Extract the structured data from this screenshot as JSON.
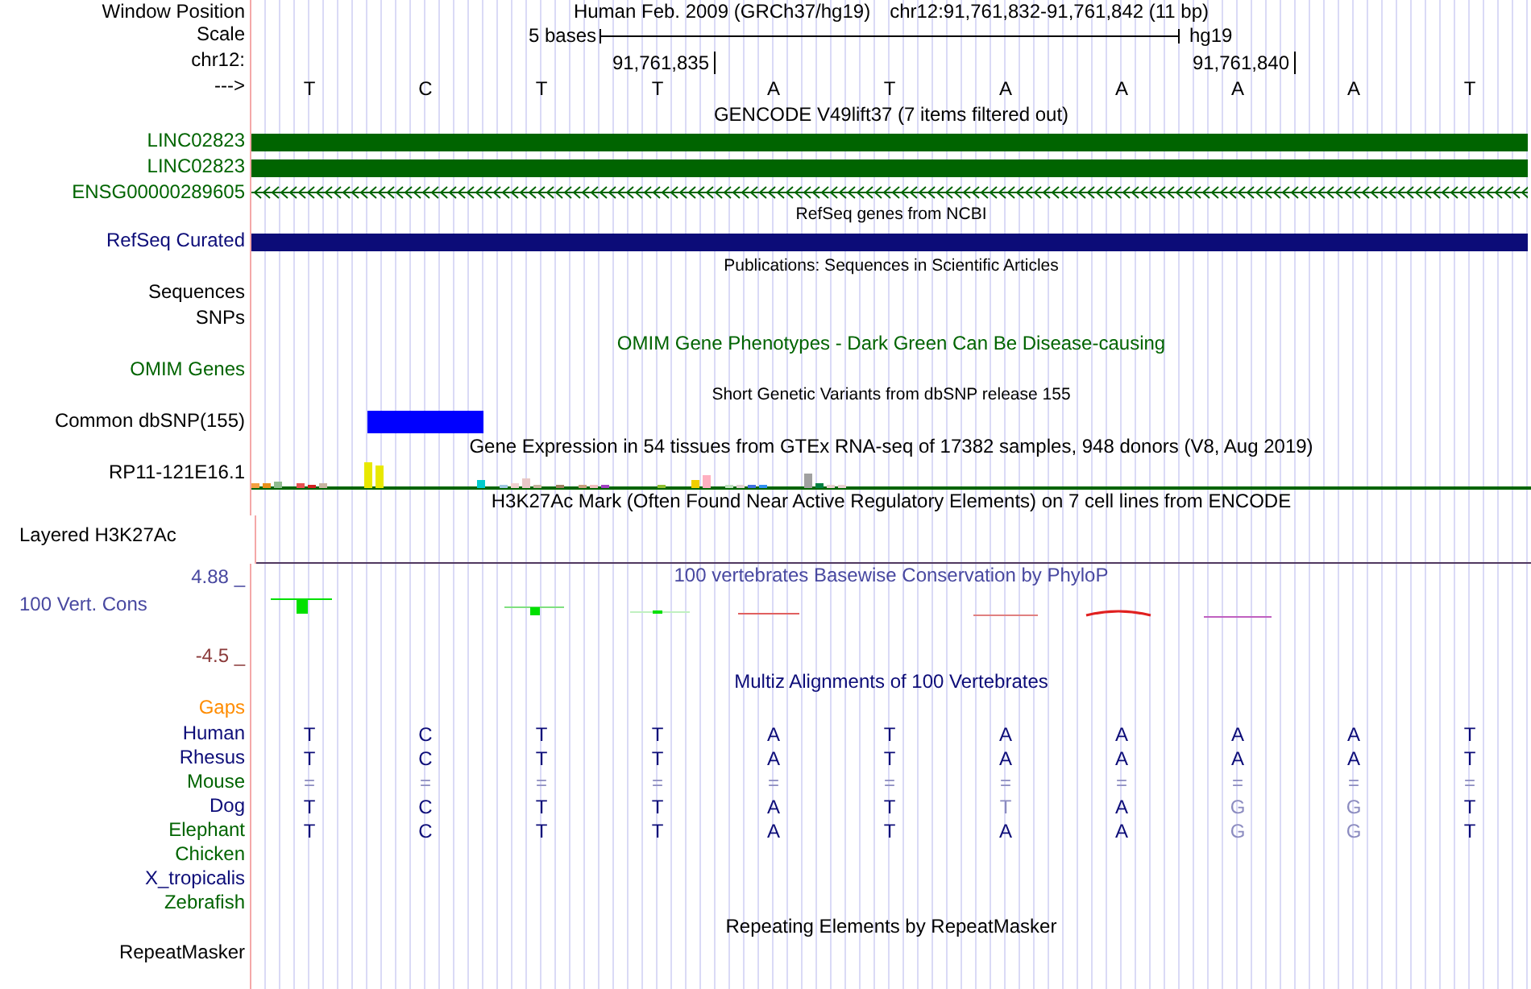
{
  "header": {
    "window_position": {
      "label": "Window Position",
      "assembly": "Human Feb. 2009 (GRCh37/hg19)",
      "range": "chr12:91,761,832-91,761,842 (11 bp)"
    },
    "scale": {
      "label": "Scale",
      "left": "5 bases",
      "right": "hg19"
    },
    "ruler": {
      "label": "chr12:",
      "ticks": [
        "91,761,835",
        "91,761,840"
      ]
    },
    "bases": {
      "label": "--->",
      "letters": [
        "T",
        "C",
        "T",
        "T",
        "A",
        "T",
        "A",
        "A",
        "A",
        "A",
        "T"
      ]
    }
  },
  "tracks": [
    {
      "kind": "title",
      "text": "GENCODE V49lift37 (7 items filtered out)",
      "color": "#000000"
    },
    {
      "kind": "bar",
      "label": "LINC02823",
      "color": "#006400"
    },
    {
      "kind": "bar",
      "label": "LINC02823",
      "color": "#006400"
    },
    {
      "kind": "arrows",
      "label": "ENSG00000289605",
      "color": "#006400"
    },
    {
      "kind": "small_title",
      "text": "RefSeq genes from NCBI"
    },
    {
      "kind": "bar",
      "label": "RefSeq Curated",
      "color": "#0c0c78"
    },
    {
      "kind": "small_title",
      "text": "Publications: Sequences in Scientific Articles"
    },
    {
      "kind": "label",
      "label": "Sequences",
      "color": "#000000"
    },
    {
      "kind": "label",
      "label": "SNPs",
      "color": "#000000"
    },
    {
      "kind": "title",
      "text": "OMIM Gene Phenotypes - Dark Green Can Be Disease-causing",
      "color": "#006400"
    },
    {
      "kind": "label",
      "label": "OMIM Genes",
      "color": "#006400"
    },
    {
      "kind": "small_title",
      "text": "Short Genetic Variants from dbSNP release 155"
    },
    {
      "kind": "snp",
      "label": "Common dbSNP(155)",
      "color": "#000000"
    },
    {
      "kind": "title",
      "text": "Gene Expression in 54 tissues from GTEx RNA-seq of 17382 samples, 948 donors (V8, Aug 2019)",
      "color": "#000000"
    },
    {
      "kind": "expression",
      "label": "RP11-121E16.1",
      "color": "#000000"
    },
    {
      "kind": "title",
      "text": "H3K27Ac Mark (Often Found Near Active Regulatory Elements) on 7 cell lines from ENCODE",
      "color": "#000000"
    },
    {
      "kind": "layered",
      "label": "Layered H3K27Ac",
      "color": "#000000"
    },
    {
      "kind": "phylop",
      "title": "100 vertebrates Basewise Conservation by PhyloP",
      "label": "100 Vert. Cons",
      "max": "4.88 _",
      "min": "-4.5 _"
    },
    {
      "kind": "title",
      "text": "Multiz Alignments of 100 Vertebrates",
      "color": "#0c0c78"
    },
    {
      "kind": "label",
      "label": "Gaps",
      "color": "#ff8c00"
    },
    {
      "kind": "species",
      "label": "Human",
      "color": "#0c0c78",
      "bases": [
        {
          "b": "T",
          "faded": false
        },
        {
          "b": "C",
          "faded": false
        },
        {
          "b": "T",
          "faded": false
        },
        {
          "b": "T",
          "faded": false
        },
        {
          "b": "A",
          "faded": false
        },
        {
          "b": "T",
          "faded": false
        },
        {
          "b": "A",
          "faded": false
        },
        {
          "b": "A",
          "faded": false
        },
        {
          "b": "A",
          "faded": false
        },
        {
          "b": "A",
          "faded": false
        },
        {
          "b": "T",
          "faded": false
        }
      ]
    },
    {
      "kind": "species",
      "label": "Rhesus",
      "color": "#0c0c78",
      "bases": [
        {
          "b": "T",
          "faded": false
        },
        {
          "b": "C",
          "faded": false
        },
        {
          "b": "T",
          "faded": false
        },
        {
          "b": "T",
          "faded": false
        },
        {
          "b": "A",
          "faded": false
        },
        {
          "b": "T",
          "faded": false
        },
        {
          "b": "A",
          "faded": false
        },
        {
          "b": "A",
          "faded": false
        },
        {
          "b": "A",
          "faded": false
        },
        {
          "b": "A",
          "faded": false
        },
        {
          "b": "T",
          "faded": false
        }
      ]
    },
    {
      "kind": "species",
      "label": "Mouse",
      "color": "#006400",
      "bases": [
        {
          "b": "=",
          "faded": true
        },
        {
          "b": "=",
          "faded": true
        },
        {
          "b": "=",
          "faded": true
        },
        {
          "b": "=",
          "faded": true
        },
        {
          "b": "=",
          "faded": true
        },
        {
          "b": "=",
          "faded": true
        },
        {
          "b": "=",
          "faded": true
        },
        {
          "b": "=",
          "faded": true
        },
        {
          "b": "=",
          "faded": true
        },
        {
          "b": "=",
          "faded": true
        },
        {
          "b": "=",
          "faded": true
        }
      ]
    },
    {
      "kind": "species",
      "label": "Dog",
      "color": "#0c0c78",
      "bases": [
        {
          "b": "T",
          "faded": false
        },
        {
          "b": "C",
          "faded": false
        },
        {
          "b": "T",
          "faded": false
        },
        {
          "b": "T",
          "faded": false
        },
        {
          "b": "A",
          "faded": false
        },
        {
          "b": "T",
          "faded": false
        },
        {
          "b": "T",
          "faded": true
        },
        {
          "b": "A",
          "faded": false
        },
        {
          "b": "G",
          "faded": true
        },
        {
          "b": "G",
          "faded": true
        },
        {
          "b": "T",
          "faded": false
        }
      ]
    },
    {
      "kind": "species",
      "label": "Elephant",
      "color": "#006400",
      "bases": [
        {
          "b": "T",
          "faded": false
        },
        {
          "b": "C",
          "faded": false
        },
        {
          "b": "T",
          "faded": false
        },
        {
          "b": "T",
          "faded": false
        },
        {
          "b": "A",
          "faded": false
        },
        {
          "b": "T",
          "faded": false
        },
        {
          "b": "A",
          "faded": false
        },
        {
          "b": "A",
          "faded": false
        },
        {
          "b": "G",
          "faded": true
        },
        {
          "b": "G",
          "faded": true
        },
        {
          "b": "T",
          "faded": false
        }
      ]
    },
    {
      "kind": "species",
      "label": "Chicken",
      "color": "#006400"
    },
    {
      "kind": "species",
      "label": "X_tropicalis",
      "color": "#0c0c78"
    },
    {
      "kind": "species",
      "label": "Zebrafish",
      "color": "#006400"
    },
    {
      "kind": "title",
      "text": "Repeating Elements by RepeatMasker",
      "color": "#000000"
    },
    {
      "kind": "label",
      "label": "RepeatMasker",
      "color": "#000000"
    }
  ]
}
